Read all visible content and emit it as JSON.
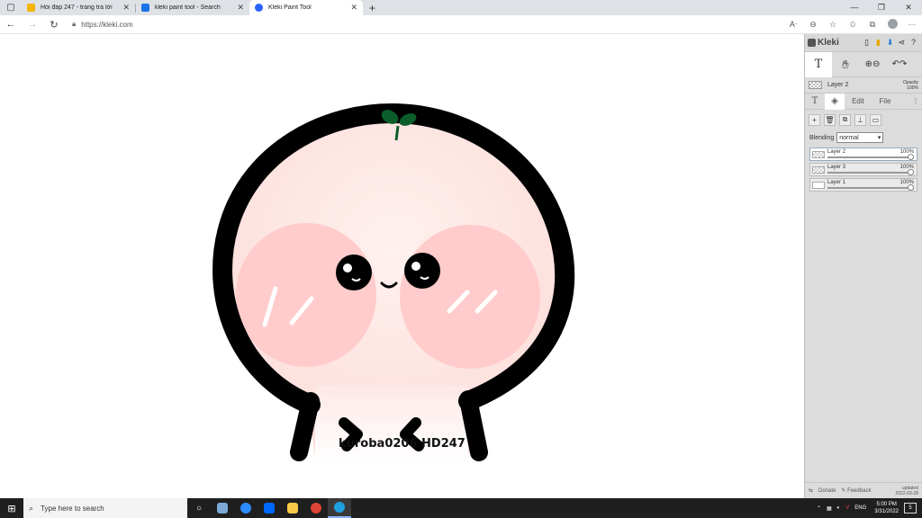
{
  "browser": {
    "tabs": [
      {
        "title": "Hỏi đáp 247 - trang tra lời",
        "favicon_color": "#f4b400",
        "active": false
      },
      {
        "title": "kleki paint tool - Search",
        "favicon_color": "#1a73e8",
        "active": false
      },
      {
        "title": "Kleki Paint Tool",
        "favicon_color": "#2962ff",
        "active": true
      }
    ],
    "new_tab": "+",
    "url": "https://kleki.com"
  },
  "drawing": {
    "watermark": "kuroba0206 HD247"
  },
  "panel": {
    "logo": "Kleki",
    "layer_info": {
      "name": "Layer 2",
      "opacity_label": "Opacity",
      "opacity_value": "100%"
    },
    "tabs": {
      "edit": "Edit",
      "file": "File"
    },
    "blending_label": "Blending",
    "blending_value": "normal",
    "layers": [
      {
        "name": "Layer 2",
        "opacity": "100%",
        "selected": true
      },
      {
        "name": "Layer 3",
        "opacity": "100%",
        "selected": false
      },
      {
        "name": "Layer 1",
        "opacity": "100%",
        "selected": false
      }
    ],
    "footer": {
      "donate": "Donate",
      "feedback": "Feedback",
      "updated_label": "updated",
      "updated_date": "2022-03-28"
    }
  },
  "taskbar": {
    "search_placeholder": "Type here to search",
    "lang": "ENG",
    "time": "5:00 PM",
    "date": "3/31/2022",
    "notifications": "5"
  },
  "colors": {
    "accent": "#2962ff",
    "taskbar": "#1f1f1f",
    "panel": "#dcdcdc",
    "cheek": "#ffcccb",
    "face": "#fde8e6",
    "leaf": "#0b5e2a"
  }
}
